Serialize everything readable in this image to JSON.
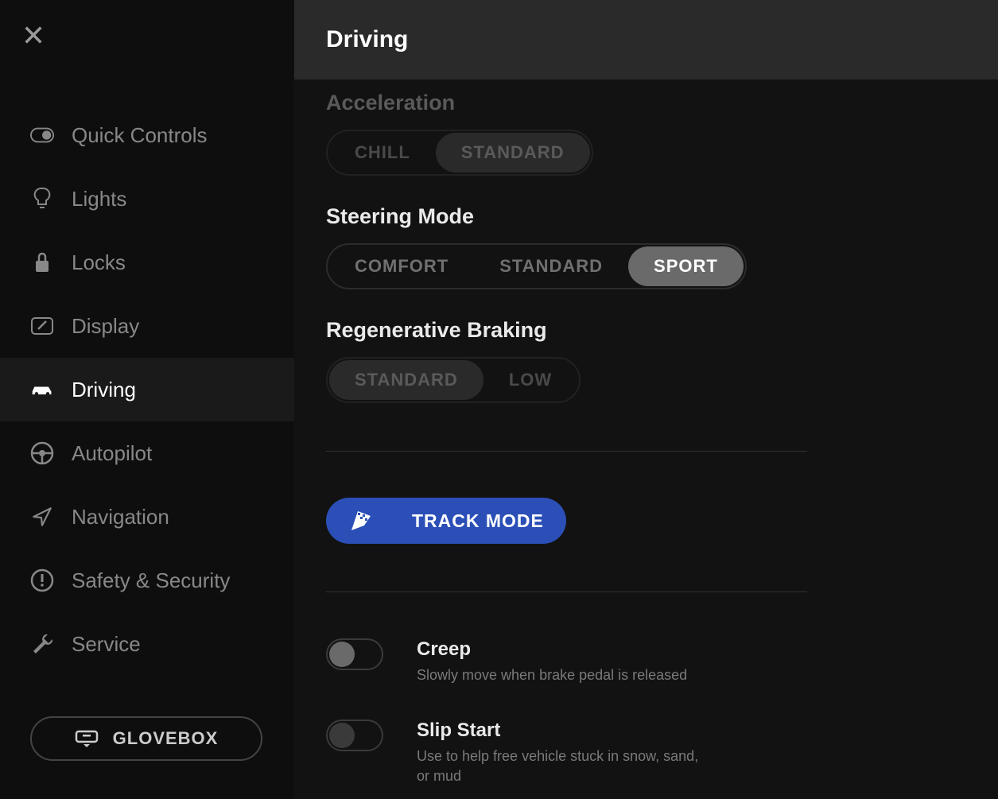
{
  "header": {
    "title": "Driving"
  },
  "sidebar": {
    "items": [
      {
        "label": "Quick Controls"
      },
      {
        "label": "Lights"
      },
      {
        "label": "Locks"
      },
      {
        "label": "Display"
      },
      {
        "label": "Driving"
      },
      {
        "label": "Autopilot"
      },
      {
        "label": "Navigation"
      },
      {
        "label": "Safety & Security"
      },
      {
        "label": "Service"
      }
    ],
    "glovebox": "GLOVEBOX"
  },
  "settings": {
    "acceleration": {
      "label": "Acceleration",
      "options": [
        "CHILL",
        "STANDARD"
      ],
      "selected": "STANDARD"
    },
    "steering": {
      "label": "Steering Mode",
      "options": [
        "COMFORT",
        "STANDARD",
        "SPORT"
      ],
      "selected": "SPORT"
    },
    "regen": {
      "label": "Regenerative Braking",
      "options": [
        "STANDARD",
        "LOW"
      ],
      "selected": "STANDARD"
    },
    "track_mode": "TRACK MODE",
    "creep": {
      "title": "Creep",
      "desc": "Slowly move when brake pedal is released",
      "on": false
    },
    "slip": {
      "title": "Slip Start",
      "desc": "Use to help free vehicle stuck in snow, sand, or mud",
      "on": false
    }
  }
}
